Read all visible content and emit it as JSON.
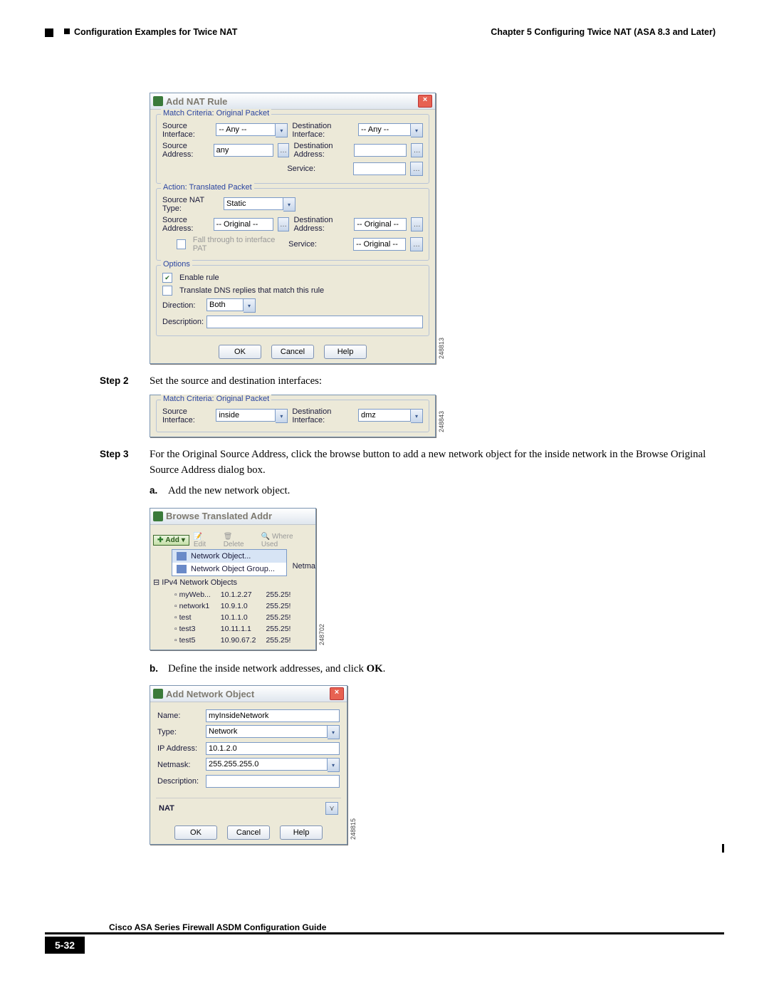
{
  "header": {
    "left": "Configuration Examples for Twice NAT",
    "right": "Chapter 5      Configuring Twice NAT (ASA 8.3 and Later)"
  },
  "dlg1": {
    "title": "Add NAT Rule",
    "fs1": {
      "legend": "Match Criteria: Original Packet",
      "srcIfLbl": "Source Interface:",
      "srcIfVal": "-- Any --",
      "dstIfLbl": "Destination Interface:",
      "dstIfVal": "-- Any --",
      "srcAddrLbl": "Source Address:",
      "srcAddrVal": "any",
      "dstAddrLbl": "Destination Address:",
      "dstAddrVal": "",
      "svcLbl": "Service:",
      "svcVal": ""
    },
    "fs2": {
      "legend": "Action: Translated Packet",
      "natTypeLbl": "Source NAT Type:",
      "natTypeVal": "Static",
      "srcAddrLbl": "Source Address:",
      "srcAddrVal": "-- Original --",
      "dstAddrLbl": "Destination Address:",
      "dstAddrVal": "-- Original --",
      "patLbl": "Fall through to interface PAT",
      "svcLbl": "Service:",
      "svcVal": "-- Original --"
    },
    "fs3": {
      "legend": "Options",
      "enableLbl": "Enable rule",
      "dnsLbl": "Translate DNS replies that match this rule",
      "dirLbl": "Direction:",
      "dirVal": "Both",
      "descLbl": "Description:",
      "descVal": ""
    },
    "ok": "OK",
    "cancel": "Cancel",
    "help": "Help",
    "imgid": "248813"
  },
  "step2": {
    "lbl": "Step 2",
    "txt": "Set the source and destination interfaces:"
  },
  "dlg2": {
    "legend": "Match Criteria: Original Packet",
    "srcIfLbl": "Source Interface:",
    "srcIfVal": "inside",
    "dstIfLbl": "Destination Interface:",
    "dstIfVal": "dmz",
    "imgid": "248843"
  },
  "step3": {
    "lbl": "Step 3",
    "txt": "For the Original Source Address, click the browse button to add a new network object for the inside network in the Browse Original Source Address dialog box."
  },
  "sub_a": {
    "lbl": "a.",
    "txt": "Add the new network object."
  },
  "dlg3": {
    "title": "Browse Translated Addr",
    "add": "Add",
    "edit": "Edit",
    "del": "Delete",
    "where": "Where Used",
    "menu": {
      "obj": "Network Object...",
      "grp": "Network Object Group..."
    },
    "cat": "IPv4 Network Objects",
    "netma": "Netma",
    "rows": [
      {
        "n": "myWeb...",
        "ip": "10.1.2.27",
        "nm": "255.25!"
      },
      {
        "n": "network1",
        "ip": "10.9.1.0",
        "nm": "255.25!"
      },
      {
        "n": "test",
        "ip": "10.1.1.0",
        "nm": "255.25!"
      },
      {
        "n": "test3",
        "ip": "10.11.1.1",
        "nm": "255.25!"
      },
      {
        "n": "test5",
        "ip": "10.90.67.2",
        "nm": "255.25!"
      }
    ],
    "imgid": "248702"
  },
  "sub_b": {
    "lbl": "b.",
    "txt_pre": "Define the inside network addresses, and click ",
    "txt_bold": "OK",
    "txt_post": "."
  },
  "dlg4": {
    "title": "Add Network Object",
    "nameLbl": "Name:",
    "nameVal": "myInsideNetwork",
    "typeLbl": "Type:",
    "typeVal": "Network",
    "ipLbl": "IP Address:",
    "ipVal": "10.1.2.0",
    "maskLbl": "Netmask:",
    "maskVal": "255.255.255.0",
    "descLbl": "Description:",
    "descVal": "",
    "nat": "NAT",
    "ok": "OK",
    "cancel": "Cancel",
    "help": "Help",
    "imgid": "248815"
  },
  "footer": {
    "page": "5-32",
    "guide": "Cisco ASA Series Firewall ASDM Configuration Guide"
  }
}
